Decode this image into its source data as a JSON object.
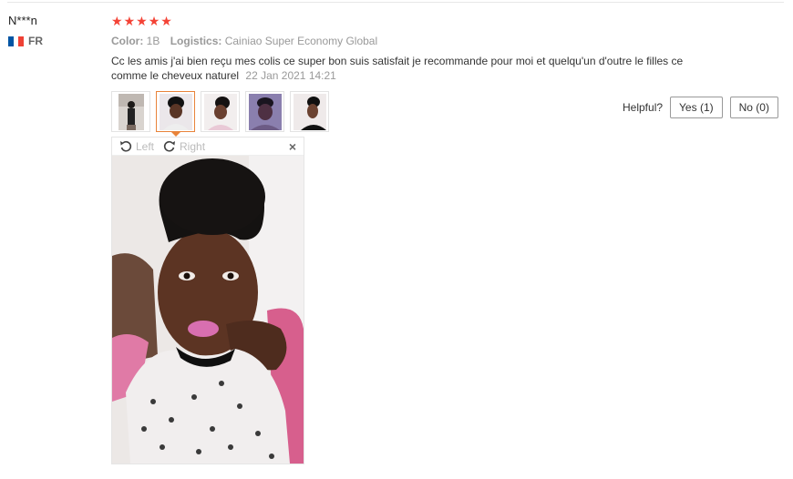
{
  "reviewer": {
    "name": "N***n",
    "country_code": "FR"
  },
  "rating": {
    "stars": 5,
    "max": 5
  },
  "meta": {
    "color_label": "Color:",
    "color_value": "1B",
    "logistics_label": "Logistics:",
    "logistics_value": "Cainiao Super Economy Global"
  },
  "review": {
    "text": "Cc les amis j'ai bien reçu mes colis ce super bon suis satisfait je recommande pour moi et quelqu'un d'outre le filles ce comme le cheveux naturel",
    "date": "22 Jan 2021 14:21"
  },
  "thumbnails": [
    {
      "alt": "photo-1"
    },
    {
      "alt": "photo-2"
    },
    {
      "alt": "photo-3"
    },
    {
      "alt": "photo-4"
    },
    {
      "alt": "photo-5"
    }
  ],
  "selected_thumbnail": 2,
  "helpful": {
    "label": "Helpful?",
    "yes_label": "Yes (1)",
    "no_label": "No (0)"
  },
  "viewer": {
    "rotate_left_label": "Left",
    "rotate_right_label": "Right",
    "close_glyph": "×"
  },
  "colors": {
    "star": "#f44336",
    "active_border": "#e8833a",
    "flag_blue": "#0055a4",
    "flag_red": "#ef4135"
  },
  "icons": {
    "rotate_left": "rotate-left-icon",
    "rotate_right": "rotate-right-icon",
    "close": "close-icon",
    "flag": "flag-fr-icon",
    "star": "star-icon"
  }
}
